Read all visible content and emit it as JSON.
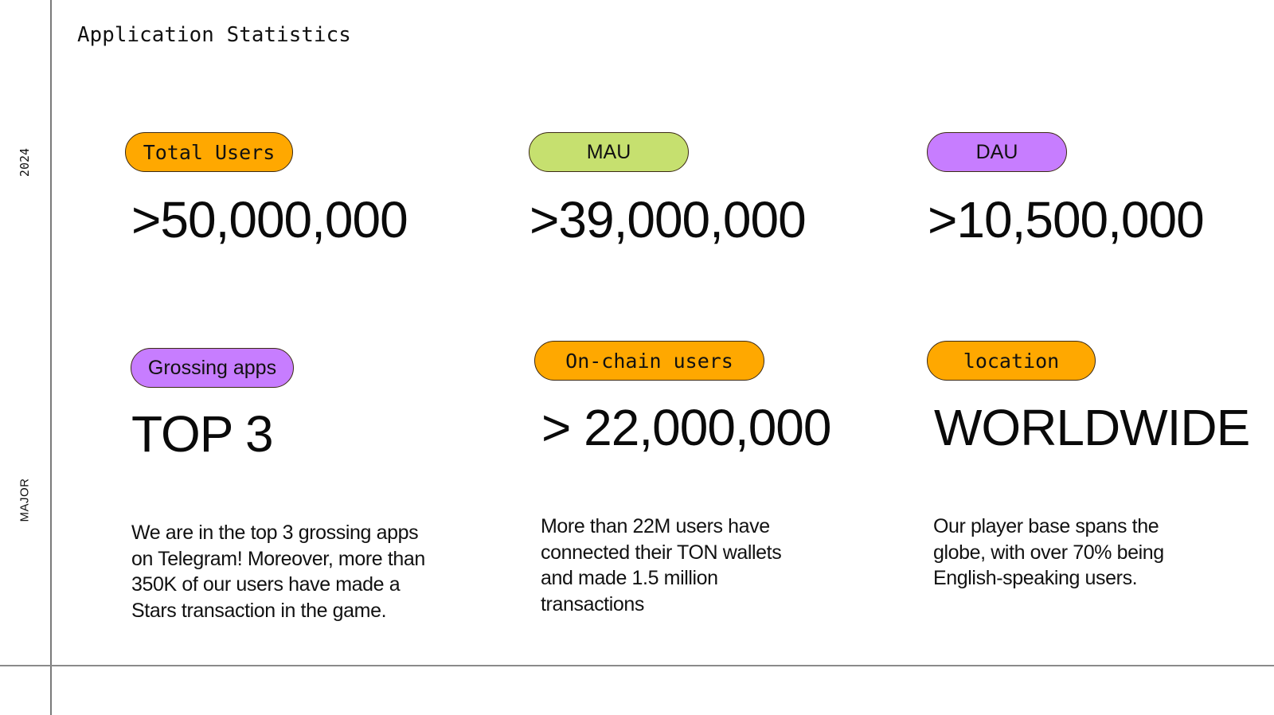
{
  "page": {
    "title": "Application Statistics",
    "side_year": "2024",
    "side_brand": "MAJOR"
  },
  "colors": {
    "orange": "#FFA800",
    "green": "#C6E06F",
    "purple": "#C77DFF",
    "pill_border": "#3B2A14"
  },
  "stats": [
    {
      "label": "Total Users",
      "value": ">50,000,000",
      "pill_color": "orange"
    },
    {
      "label": "MAU",
      "value": ">39,000,000",
      "pill_color": "green"
    },
    {
      "label": "DAU",
      "value": ">10,500,000",
      "pill_color": "purple"
    },
    {
      "label": "Grossing apps",
      "value": "TOP 3",
      "pill_color": "purple",
      "description": [
        "We are in the top 3 grossing apps",
        "on Telegram! Moreover, more than",
        "350K of our users have made a",
        "Stars transaction in the game."
      ]
    },
    {
      "label": "On-chain users",
      "value": "> 22,000,000",
      "pill_color": "orange",
      "description": [
        "More than 22M users have",
        "connected their TON wallets",
        "and made 1.5 million",
        "transactions"
      ]
    },
    {
      "label": "location",
      "value": "WORLDWIDE",
      "pill_color": "orange",
      "description": [
        "Our player base spans the",
        "globe, with over 70% being",
        "English-speaking users."
      ]
    }
  ]
}
